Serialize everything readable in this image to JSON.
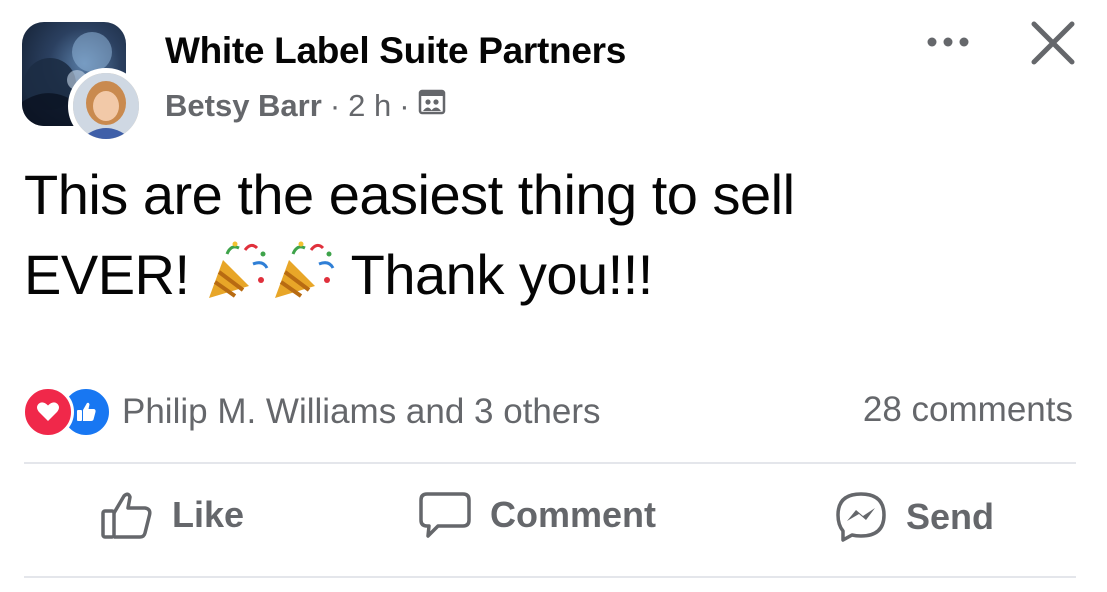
{
  "post": {
    "group_name": "White Label Suite Partners",
    "author": "Betsy Barr",
    "separator": "·",
    "time": "2 h",
    "text_line1": "This are the easiest thing to sell",
    "text_line2_before": "EVER!",
    "text_line2_after": "Thank you!!!",
    "emoji": "party-popper"
  },
  "reactions": {
    "types": [
      "love",
      "like"
    ],
    "summary": "Philip M. Williams and 3 others",
    "comments": "28 comments"
  },
  "actions": {
    "like_label": "Like",
    "comment_label": "Comment",
    "send_label": "Send"
  },
  "colors": {
    "text_primary": "#050505",
    "text_secondary": "#65676b",
    "love": "#f0284a",
    "like": "#1877f2",
    "divider": "#e4e6eb"
  },
  "icons": {
    "more": "more-horizontal-icon",
    "close": "close-icon",
    "privacy": "group-members-icon",
    "like": "thumbs-up-outline-icon",
    "comment": "speech-bubble-icon",
    "send": "messenger-icon"
  }
}
